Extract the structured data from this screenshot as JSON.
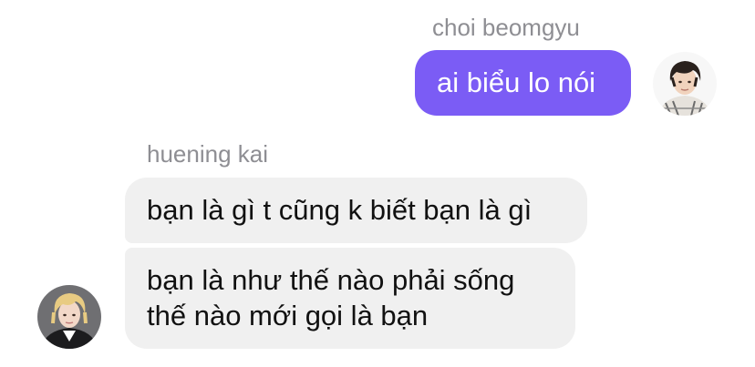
{
  "outgoing": {
    "sender_name": "choi beomgyu",
    "avatar_icon": "beomgyu-avatar-icon",
    "messages": [
      {
        "text": "ai biểu lo nói"
      }
    ],
    "bubble_color": "#7b5cf5"
  },
  "incoming": {
    "sender_name": "huening kai",
    "avatar_icon": "hueningkai-avatar-icon",
    "messages": [
      {
        "text": "bạn là gì t cũng k biết bạn là gì"
      },
      {
        "lines": [
          "bạn là như thế nào phải sống",
          "thế nào mới gọi là bạn"
        ]
      }
    ],
    "bubble_color": "#f0f0f0"
  }
}
